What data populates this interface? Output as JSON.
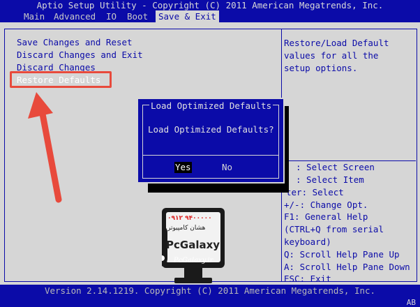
{
  "title": "Aptio Setup Utility - Copyright (C) 2011 American Megatrends, Inc.",
  "tabs": [
    {
      "label": "Main",
      "active": false
    },
    {
      "label": "Advanced",
      "active": false
    },
    {
      "label": "IO",
      "active": false
    },
    {
      "label": "Boot",
      "active": false
    },
    {
      "label": "Save & Exit",
      "active": true
    }
  ],
  "menu": [
    {
      "label": "Save Changes and Reset",
      "selected": false
    },
    {
      "label": "Discard Changes and Exit",
      "selected": false
    },
    {
      "label": "Discard Changes",
      "selected": false
    },
    {
      "label": "Restore Defaults",
      "selected": true
    }
  ],
  "help_text": [
    "Restore/Load Default",
    "values for all the",
    "setup options."
  ],
  "keys": [
    ": Select Screen",
    ": Select Item",
    "ter: Select",
    "+/-: Change Opt.",
    "F1: General Help",
    "(CTRL+Q from serial",
    "keyboard)",
    "Q: Scroll Help Pane Up",
    "A: Scroll Help Pane Down",
    "ESC: Exit"
  ],
  "dialog": {
    "title": "Load Optimized Defaults",
    "question": "Load Optimized Defaults?",
    "yes": "Yes",
    "no": "No"
  },
  "footer": "Version 2.14.1219. Copyright (C) 2011 American Megatrends, Inc.",
  "corner": "AB",
  "watermark": {
    "phone": "۰۹۱۲ ۹۴۰۰۰۰۰",
    "brand_fa": "هشان کامپیوتر",
    "brand": "PcGalaxy",
    "site": "PcGalaxy.ir"
  },
  "colors": {
    "bios_blue": "#0b0ba8",
    "bios_gray": "#d6d6d6",
    "annotation_red": "#e84a3c"
  }
}
